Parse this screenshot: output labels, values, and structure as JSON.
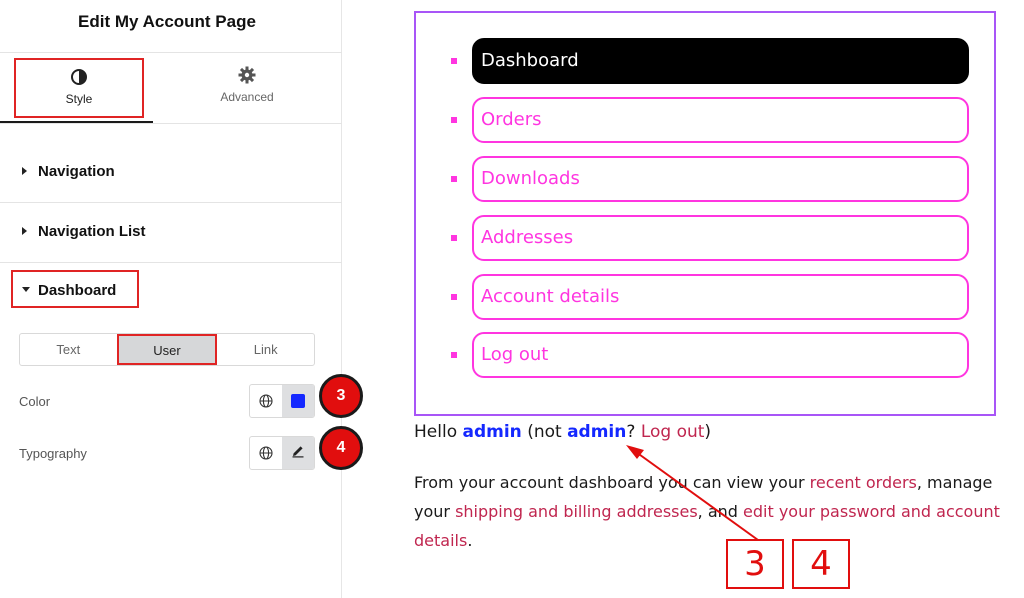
{
  "panel": {
    "title": "Edit My Account Page",
    "tabs": [
      {
        "label": "Style",
        "icon": "half-circle-icon"
      },
      {
        "label": "Advanced",
        "icon": "gear-icon"
      }
    ],
    "sections": {
      "navigation": "Navigation",
      "navigation_list": "Navigation List",
      "dashboard": "Dashboard"
    },
    "segmented": [
      "Text",
      "User",
      "Link"
    ],
    "active_segment": "User",
    "color_label": "Color",
    "typography_label": "Typography",
    "color_value": "#1428ff",
    "badges": [
      "3",
      "4"
    ]
  },
  "preview": {
    "nav_items": [
      "Dashboard",
      "Orders",
      "Downloads",
      "Addresses",
      "Account details",
      "Log out"
    ],
    "active_nav": "Dashboard",
    "nav_color": "#ff35e0",
    "hello": {
      "prefix": "Hello ",
      "username": "admin",
      "middle": " (not ",
      "username2": "admin",
      "question": "? ",
      "logout": "Log out",
      "suffix": ")"
    },
    "intro": {
      "p1": "From your account dashboard you can view your ",
      "link1": "recent orders",
      "p2": ", manage your ",
      "link2": "shipping and billing addresses",
      "p3": ", and ",
      "link3": "edit your password and account details",
      "p4": "."
    }
  },
  "annotations": {
    "callouts": [
      "3",
      "4"
    ],
    "accent": "#e10e0e"
  }
}
